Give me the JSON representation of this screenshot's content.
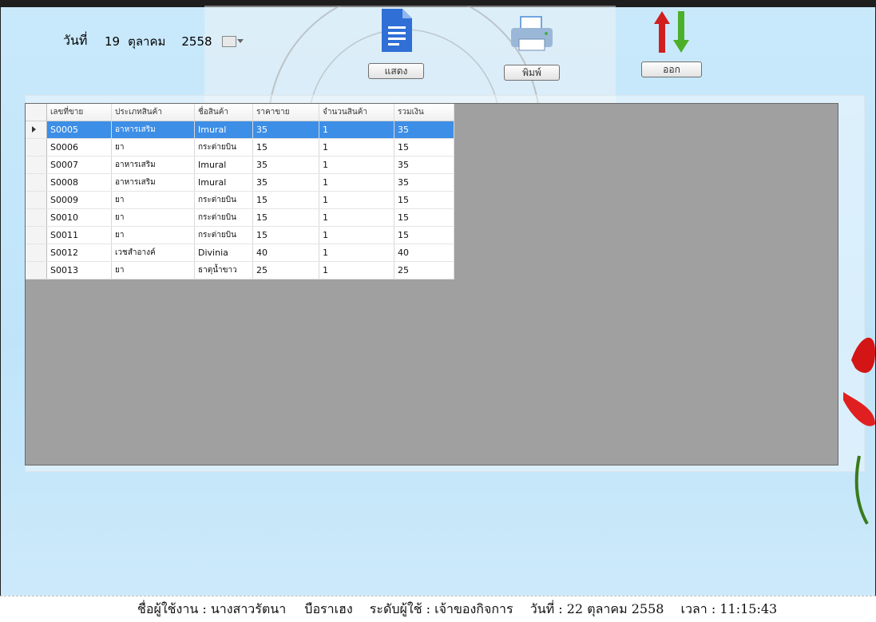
{
  "header": {
    "date_label": "วันที่",
    "date": {
      "day": "19",
      "month": "ตุลาคม",
      "year": "2558"
    }
  },
  "toolbar": {
    "show_label": "แสดง",
    "print_label": "พิมพ์",
    "exit_label": "ออก"
  },
  "grid": {
    "columns": [
      "เลขที่ขาย",
      "ประเภทสินค้า",
      "ชื่อสินค้า",
      "ราคาขาย",
      "จำนวนสินค้า",
      "รวมเงิน"
    ],
    "rows": [
      [
        "S0005",
        "อาหารเสริม",
        "Imural",
        "35",
        "1",
        "35"
      ],
      [
        "S0006",
        "ยา",
        "กระต่ายบิน",
        "15",
        "1",
        "15"
      ],
      [
        "S0007",
        "อาหารเสริม",
        "Imural",
        "35",
        "1",
        "35"
      ],
      [
        "S0008",
        "อาหารเสริม",
        "Imural",
        "35",
        "1",
        "35"
      ],
      [
        "S0009",
        "ยา",
        "กระต่ายบิน",
        "15",
        "1",
        "15"
      ],
      [
        "S0010",
        "ยา",
        "กระต่ายบิน",
        "15",
        "1",
        "15"
      ],
      [
        "S0011",
        "ยา",
        "กระต่ายบิน",
        "15",
        "1",
        "15"
      ],
      [
        "S0012",
        "เวชสำอางค์",
        "Divinia",
        "40",
        "1",
        "40"
      ],
      [
        "S0013",
        "ยา",
        "ธาตุน้ำขาว",
        "25",
        "1",
        "25"
      ]
    ],
    "selected_row": 0
  },
  "status_bar": {
    "user": "ชื่อผู้ใช้งาน : นางสาวรัตนา",
    "surname": "บือราเฮง",
    "level": "ระดับผู้ใช้ : เจ้าของกิจการ",
    "date": "วันที่ : 22 ตุลาคม 2558",
    "time": "เวลา : 11:15:43"
  },
  "colors": {
    "selection": "#3d8ee6",
    "grid_background": "#a0a0a0",
    "window_background": "#c9e9fb"
  }
}
